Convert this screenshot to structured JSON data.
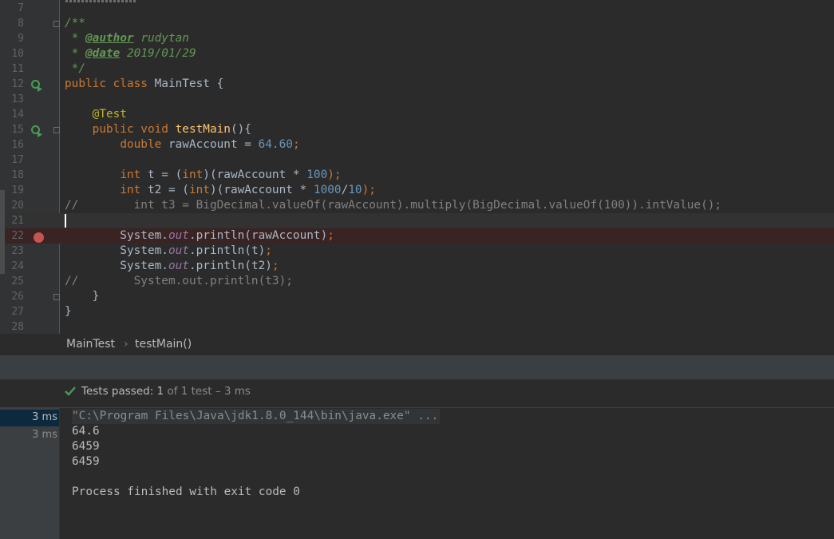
{
  "editor": {
    "top_line_number": "7",
    "lines": [
      {
        "num": "8",
        "parts": [
          {
            "t": "/**",
            "c": "doc"
          }
        ]
      },
      {
        "num": "9",
        "parts": [
          {
            "t": " * ",
            "c": "doc"
          },
          {
            "t": "@author",
            "c": "doc-tag"
          },
          {
            "t": " rudytan",
            "c": "doc"
          }
        ]
      },
      {
        "num": "10",
        "parts": [
          {
            "t": " * ",
            "c": "doc"
          },
          {
            "t": "@date",
            "c": "doc-tag"
          },
          {
            "t": " 2019/01/29",
            "c": "doc"
          }
        ]
      },
      {
        "num": "11",
        "parts": [
          {
            "t": " */",
            "c": "doc"
          }
        ]
      },
      {
        "num": "12",
        "parts": [
          {
            "t": "public class ",
            "c": "kw"
          },
          {
            "t": "MainTest {",
            "c": ""
          }
        ]
      },
      {
        "num": "13",
        "parts": []
      },
      {
        "num": "14",
        "parts": [
          {
            "t": "    ",
            "c": ""
          },
          {
            "t": "@Test",
            "c": "ann"
          }
        ]
      },
      {
        "num": "15",
        "parts": [
          {
            "t": "    ",
            "c": ""
          },
          {
            "t": "public void ",
            "c": "kw"
          },
          {
            "t": "testMain",
            "c": "fn"
          },
          {
            "t": "(){",
            "c": ""
          }
        ]
      },
      {
        "num": "16",
        "parts": [
          {
            "t": "        ",
            "c": ""
          },
          {
            "t": "double ",
            "c": "kw"
          },
          {
            "t": "rawAccount = ",
            "c": ""
          },
          {
            "t": "64.60",
            "c": "num-lit"
          },
          {
            "t": ";",
            "c": "kw"
          }
        ]
      },
      {
        "num": "17",
        "parts": []
      },
      {
        "num": "18",
        "parts": [
          {
            "t": "        ",
            "c": ""
          },
          {
            "t": "int ",
            "c": "kw"
          },
          {
            "t": "t = (",
            "c": ""
          },
          {
            "t": "int",
            "c": "kw"
          },
          {
            "t": ")(rawAccount * ",
            "c": ""
          },
          {
            "t": "100",
            "c": "num-lit"
          },
          {
            "t": ");",
            "c": "kw"
          }
        ]
      },
      {
        "num": "19",
        "parts": [
          {
            "t": "        ",
            "c": ""
          },
          {
            "t": "int ",
            "c": "kw"
          },
          {
            "t": "t2 = (",
            "c": ""
          },
          {
            "t": "int",
            "c": "kw"
          },
          {
            "t": ")(rawAccount * ",
            "c": ""
          },
          {
            "t": "1000",
            "c": "num-lit"
          },
          {
            "t": "/",
            "c": ""
          },
          {
            "t": "10",
            "c": "num-lit"
          },
          {
            "t": ");",
            "c": "kw"
          }
        ]
      },
      {
        "num": "20",
        "parts": [
          {
            "t": "//        int t3 = BigDecimal.valueOf(rawAccount).multiply(BigDecimal.valueOf(100)).intValue();",
            "c": "cmt"
          }
        ]
      },
      {
        "num": "21",
        "parts": []
      },
      {
        "num": "22",
        "parts": [
          {
            "t": "        System.",
            "c": ""
          },
          {
            "t": "out",
            "c": "fld"
          },
          {
            "t": ".println(rawAccount)",
            "c": ""
          },
          {
            "t": ";",
            "c": "kw"
          }
        ]
      },
      {
        "num": "23",
        "parts": [
          {
            "t": "        System.",
            "c": ""
          },
          {
            "t": "out",
            "c": "fld"
          },
          {
            "t": ".println(t)",
            "c": ""
          },
          {
            "t": ";",
            "c": "kw"
          }
        ]
      },
      {
        "num": "24",
        "parts": [
          {
            "t": "        System.",
            "c": ""
          },
          {
            "t": "out",
            "c": "fld"
          },
          {
            "t": ".println(t2)",
            "c": ""
          },
          {
            "t": ";",
            "c": "kw"
          }
        ]
      },
      {
        "num": "25",
        "parts": [
          {
            "t": "//        System.out.println(t3);",
            "c": "cmt"
          }
        ]
      },
      {
        "num": "26",
        "parts": [
          {
            "t": "    }",
            "c": ""
          }
        ]
      },
      {
        "num": "27",
        "parts": [
          {
            "t": "}",
            "c": ""
          }
        ]
      },
      {
        "num": "28",
        "parts": []
      }
    ]
  },
  "breadcrumb": {
    "class_name": "MainTest",
    "separator": "›",
    "method_name": "testMain()"
  },
  "test_status": {
    "label": "Tests passed:",
    "passed": "1",
    "total": "of 1 test",
    "duration": "– 3 ms"
  },
  "test_tree": [
    {
      "time": "3 ms"
    },
    {
      "time": "3 ms"
    }
  ],
  "console": {
    "lines": [
      "\"C:\\Program Files\\Java\\jdk1.8.0_144\\bin\\java.exe\" ...",
      "64.6",
      "6459",
      "6459",
      "",
      "Process finished with exit code 0"
    ]
  },
  "colors": {
    "background": "#2b2b2b",
    "keyword": "#cc7832",
    "number": "#6897bb",
    "annotation": "#bbb529",
    "method": "#ffc66d",
    "doc": "#629755",
    "comment": "#808080",
    "breakpoint": "#c75450",
    "pass_check": "#499c54"
  }
}
